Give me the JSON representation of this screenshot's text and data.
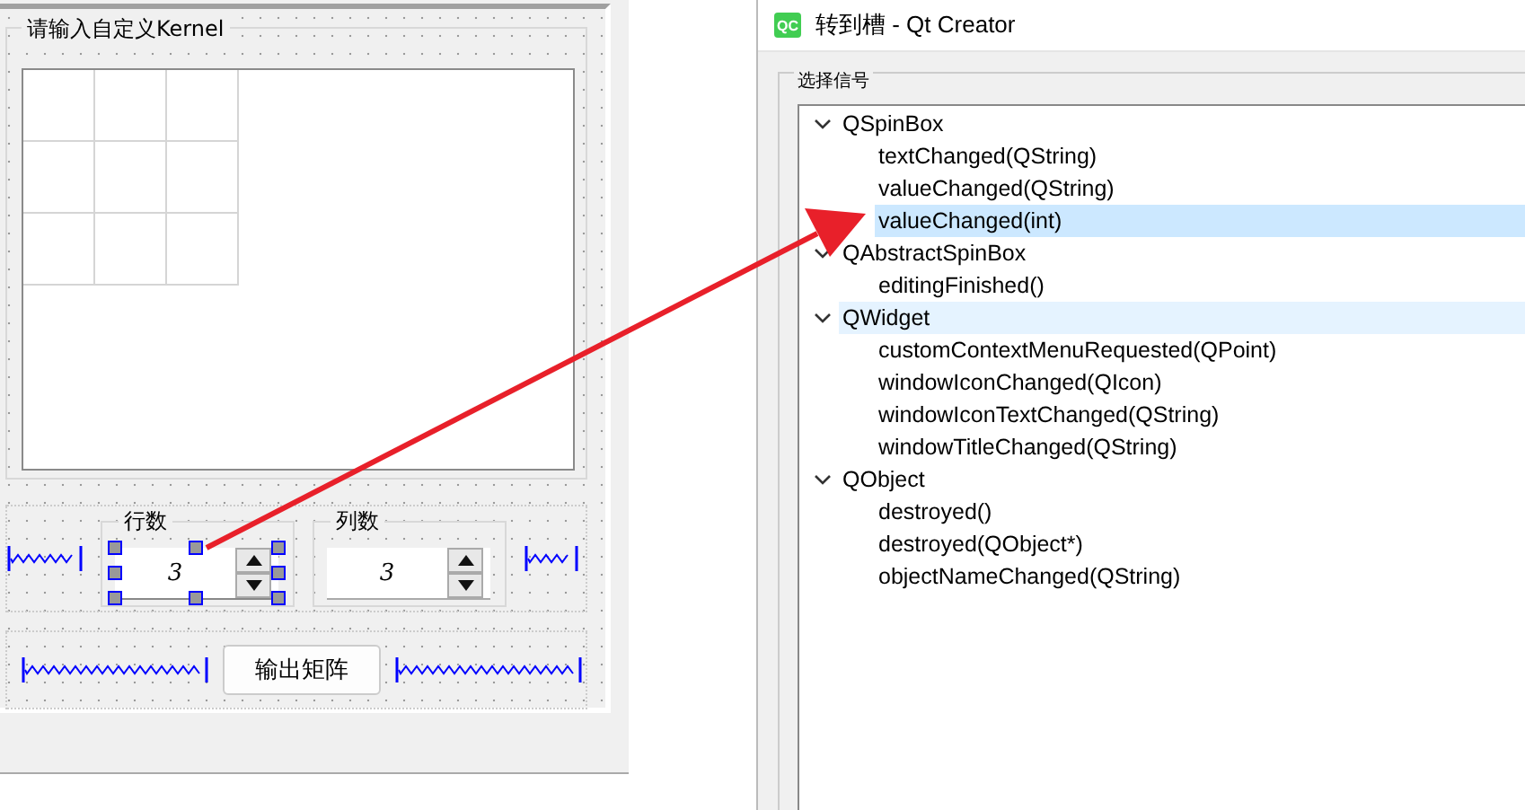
{
  "designer": {
    "groupbox_title": "请输入自定义Kernel",
    "spinboxes": [
      {
        "label": "行数",
        "value": "3",
        "selected": true
      },
      {
        "label": "列数",
        "value": "3",
        "selected": false
      }
    ],
    "button": "输出矩阵"
  },
  "dialog": {
    "title": "转到槽 - Qt Creator",
    "app_icon": "QC",
    "group_label": "选择信号",
    "tree": [
      {
        "label": "QSpinBox",
        "expanded": true,
        "selected": false,
        "hovered": false,
        "children": [
          {
            "label": "textChanged(QString)",
            "selected": false,
            "hovered": false
          },
          {
            "label": "valueChanged(QString)",
            "selected": false,
            "hovered": false
          },
          {
            "label": "valueChanged(int)",
            "selected": true,
            "hovered": false
          }
        ]
      },
      {
        "label": "QAbstractSpinBox",
        "expanded": true,
        "selected": false,
        "hovered": false,
        "children": [
          {
            "label": "editingFinished()",
            "selected": false,
            "hovered": false
          }
        ]
      },
      {
        "label": "QWidget",
        "expanded": true,
        "selected": false,
        "hovered": true,
        "children": [
          {
            "label": "customContextMenuRequested(QPoint)",
            "selected": false,
            "hovered": false
          },
          {
            "label": "windowIconChanged(QIcon)",
            "selected": false,
            "hovered": false
          },
          {
            "label": "windowIconTextChanged(QString)",
            "selected": false,
            "hovered": false
          },
          {
            "label": "windowTitleChanged(QString)",
            "selected": false,
            "hovered": false
          }
        ]
      },
      {
        "label": "QObject",
        "expanded": true,
        "selected": false,
        "hovered": false,
        "children": [
          {
            "label": "destroyed()",
            "selected": false,
            "hovered": false
          },
          {
            "label": "destroyed(QObject*)",
            "selected": false,
            "hovered": false
          },
          {
            "label": "objectNameChanged(QString)",
            "selected": false,
            "hovered": false
          }
        ]
      }
    ]
  }
}
